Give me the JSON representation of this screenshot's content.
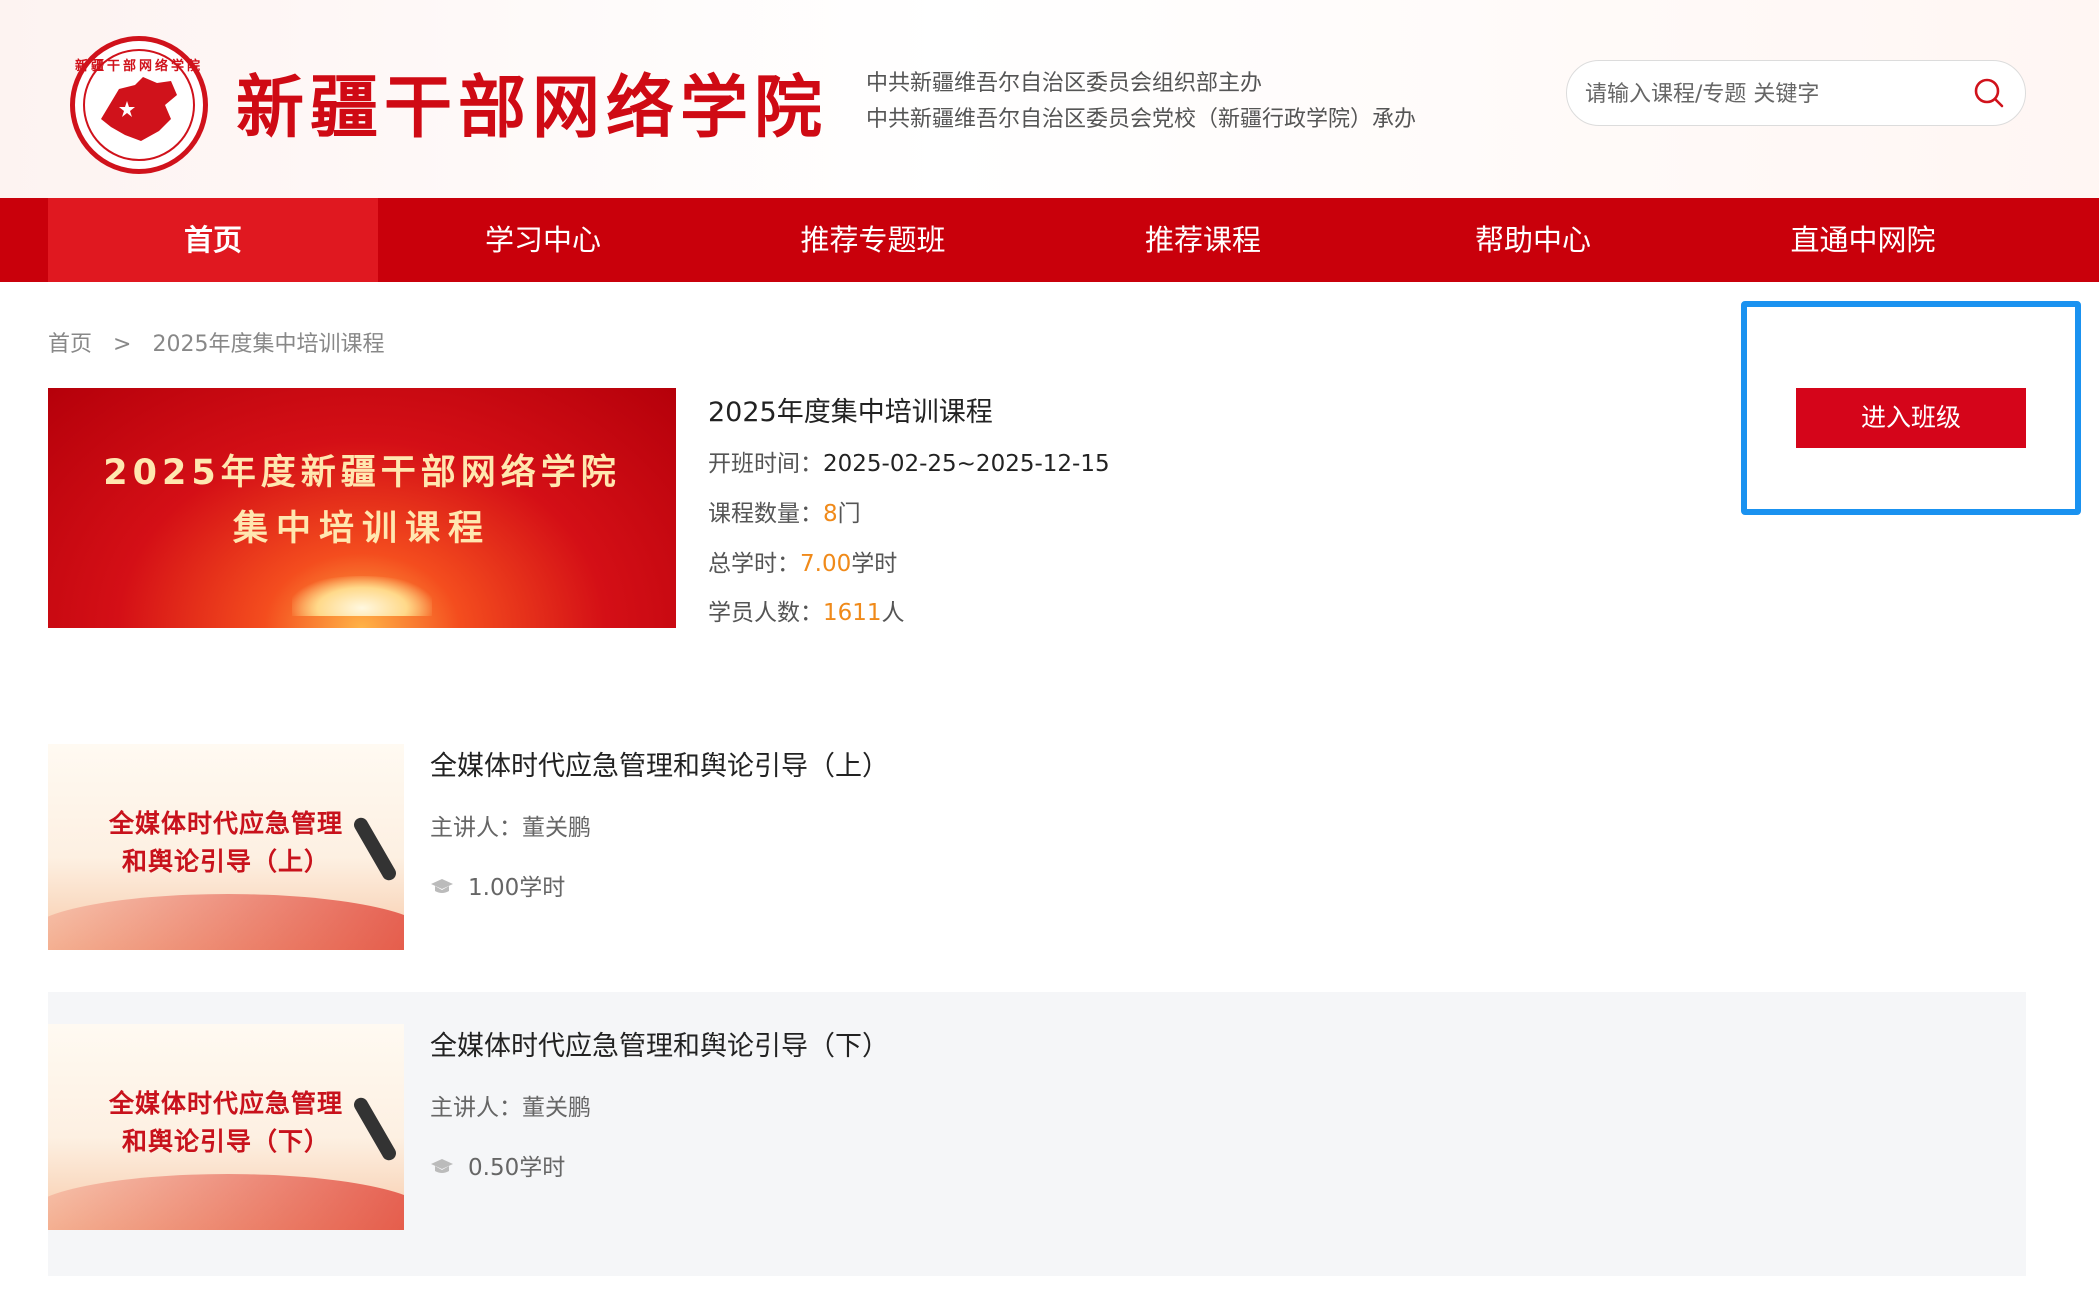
{
  "header": {
    "logo_text": "新疆干部网络学院",
    "site_title": "新疆干部网络学院",
    "host_line1": "中共新疆维吾尔自治区委员会组织部主办",
    "host_line2": "中共新疆维吾尔自治区委员会党校（新疆行政学院）承办",
    "search_placeholder": "请输入课程/专题 关键字",
    "search_icon": "search-icon",
    "brand_color": "#c9000b"
  },
  "nav": {
    "items": [
      {
        "label": "首页",
        "active": true
      },
      {
        "label": "学习中心"
      },
      {
        "label": "推荐专题班"
      },
      {
        "label": "推荐课程"
      },
      {
        "label": "帮助中心"
      },
      {
        "label": "直通中网院"
      }
    ]
  },
  "breadcrumb": {
    "home": "首页",
    "separator": ">",
    "current": "2025年度集中培训课程"
  },
  "class": {
    "banner_line1": "2025年度新疆干部网络学院",
    "banner_line2": "集中培训课程",
    "title": "2025年度集中培训课程",
    "period_label": "开班时间：",
    "period_value": "2025-02-25~2025-12-15",
    "count_label": "课程数量：",
    "count_value": "8",
    "count_unit": "门",
    "hours_label": "总学时：",
    "hours_value": "7.00",
    "hours_unit": "学时",
    "students_label": "学员人数：",
    "students_value": "1611",
    "students_unit": "人",
    "enter_button": "进入班级",
    "highlight_color": "#f08a1a"
  },
  "courses": [
    {
      "thumb_line1": "全媒体时代应急管理",
      "thumb_line2": "和舆论引导（上）",
      "title": "全媒体时代应急管理和舆论引导（上）",
      "teacher": "主讲人：董关鹏",
      "hours": "1.00学时"
    },
    {
      "thumb_line1": "全媒体时代应急管理",
      "thumb_line2": "和舆论引导（下）",
      "title": "全媒体时代应急管理和舆论引导（下）",
      "teacher": "主讲人：董关鹏",
      "hours": "0.50学时"
    }
  ]
}
